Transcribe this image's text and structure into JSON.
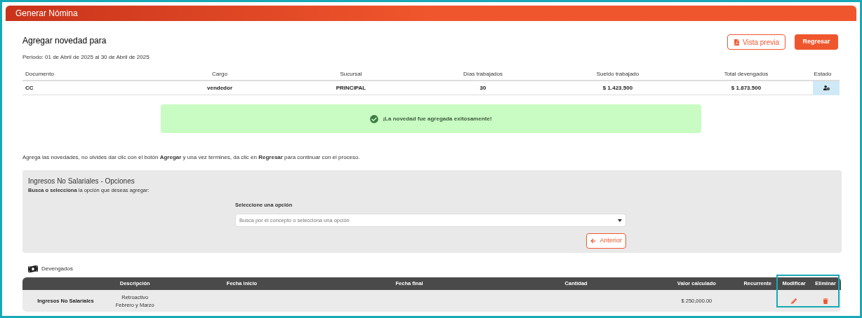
{
  "window": {
    "title": "Generar Nómina"
  },
  "header": {
    "title": "Agregar novedad para",
    "period": "Periodo: 01 de Abril de 2025 al 30 de Abril de 2025",
    "buttons": [
      {
        "kind": "outline",
        "label": "Vista previa"
      },
      {
        "kind": "solid",
        "label": "Regresar"
      }
    ]
  },
  "employee_table": {
    "columns": [
      "Documento",
      "Cargo",
      "Sucursal",
      "Días trabajados",
      "Sueldo trabajado",
      "Total devengados",
      "Estado"
    ],
    "rows": [
      {
        "cells": [
          "CC",
          "vendedor",
          "PRINCIPAL",
          "30",
          "$ 1.423.500",
          "$ 1.873.500"
        ]
      }
    ]
  },
  "alert": {
    "message": "¡La novedad fue agregada exitosamente!"
  },
  "instructions": "Agrega las novedades, no olvides dar clic con el botón **Agregar** y una vez termines, da clic en **Regresar** para continuar con el proceso.",
  "options_panel": {
    "title": "Ingresos No Salariales - Opciones",
    "hint": "**Busca o selecciona** la opción que deseas agregar:",
    "select_label": "Seleccione una opción",
    "placeholder": "Busca por el concepto o selecciona una opción",
    "back_button": "Anterior"
  },
  "earnings": {
    "title": "Devengados",
    "columns": [
      "",
      "Descripción",
      "Fecha inicio",
      "Fecha final",
      "Cantidad",
      "Valor calculado",
      "Recurrente",
      "Modificar",
      "Eliminar"
    ],
    "rows": [
      {
        "concept": "Ingresos No Salariales",
        "description": [
          "Retroactivo",
          "Febrero y Marzo"
        ],
        "start": "",
        "end": "",
        "quantity": "",
        "value": "$ 250,000.00",
        "recurring": ""
      }
    ]
  }
}
